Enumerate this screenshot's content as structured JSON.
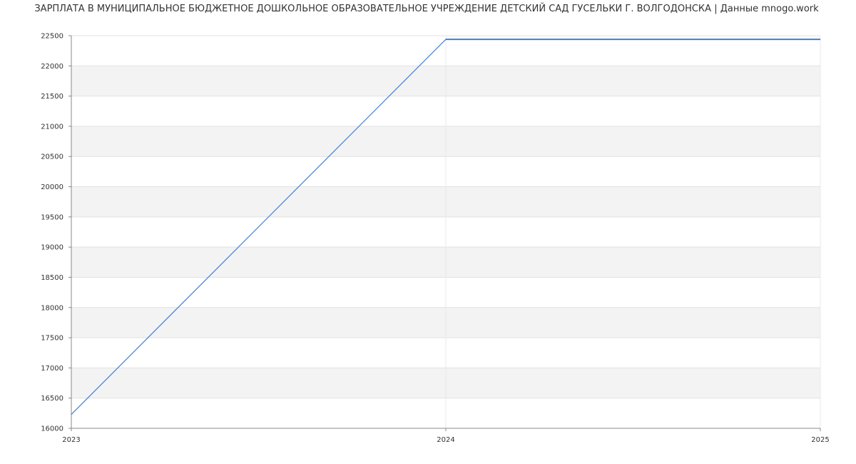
{
  "title": "ЗАРПЛАТА В МУНИЦИПАЛЬНОЕ БЮДЖЕТНОЕ ДОШКОЛЬНОЕ ОБРАЗОВАТЕЛЬНОЕ УЧРЕЖДЕНИЕ ДЕТСКИЙ САД ГУСЕЛЬКИ Г. ВОЛГОДОНСКА | Данные mnogo.work",
  "chart_data": {
    "type": "line",
    "title": "ЗАРПЛАТА В МУНИЦИПАЛЬНОЕ БЮДЖЕТНОЕ ДОШКОЛЬНОЕ ОБРАЗОВАТЕЛЬНОЕ УЧРЕЖДЕНИЕ ДЕТСКИЙ САД ГУСЕЛЬКИ Г. ВОЛГОДОНСКА | Данные mnogo.work",
    "xlabel": "",
    "ylabel": "",
    "x": [
      2023,
      2024,
      2025
    ],
    "x_tick_labels": [
      "2023",
      "2024",
      "2025"
    ],
    "y_tick_labels": [
      "16000",
      "16500",
      "17000",
      "17500",
      "18000",
      "18500",
      "19000",
      "19500",
      "20000",
      "20500",
      "21000",
      "21500",
      "22000",
      "22500"
    ],
    "xlim": [
      2023,
      2025
    ],
    "ylim": [
      16000,
      22500
    ],
    "series": [
      {
        "values": [
          16230,
          22440,
          22440
        ]
      }
    ],
    "grid": true,
    "line_color": "#3d7fd4",
    "band_color": "#f3f3f3"
  }
}
